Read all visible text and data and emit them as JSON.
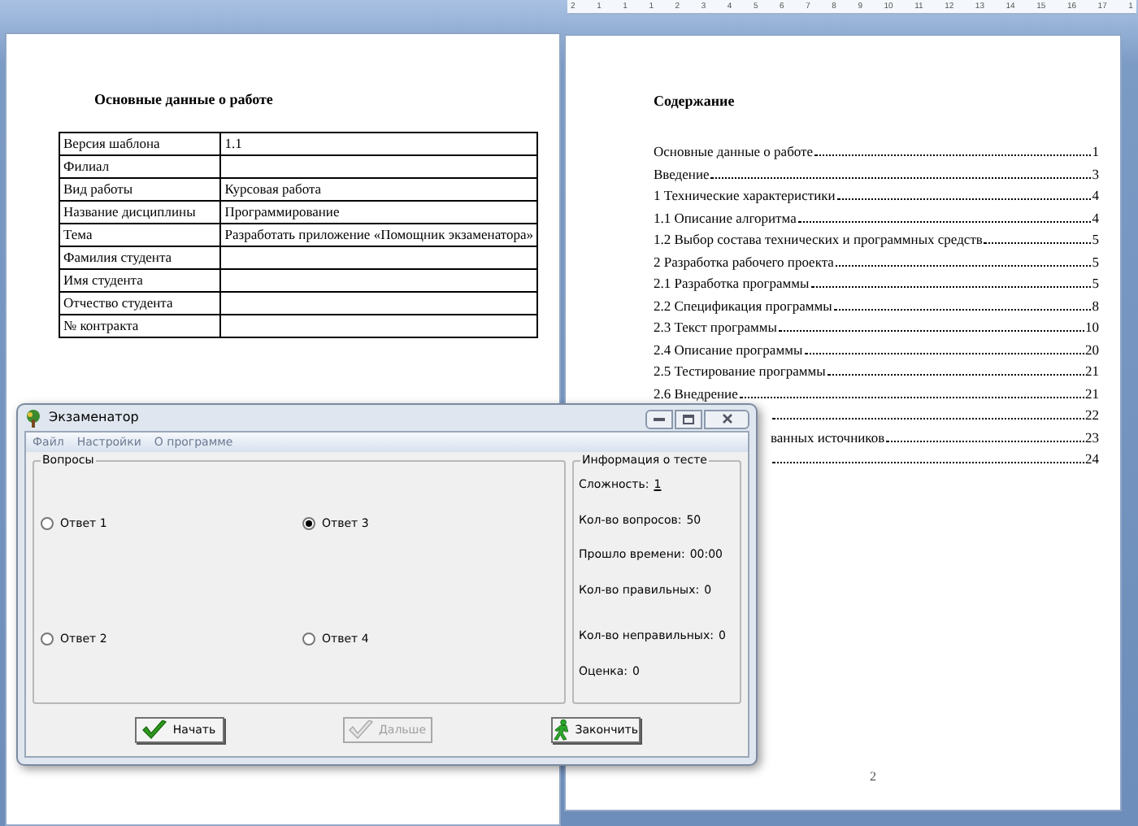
{
  "ruler": {
    "labels": [
      "2",
      "1",
      "1",
      "1",
      "2",
      "3",
      "4",
      "5",
      "6",
      "7",
      "8",
      "9",
      "10",
      "11",
      "12",
      "13",
      "14",
      "15",
      "16",
      "17",
      "1"
    ]
  },
  "left_page": {
    "heading": "Основные данные о работе",
    "table": {
      "rows": [
        {
          "label": "Версия шаблона",
          "value": "1.1"
        },
        {
          "label": "Филиал"
        },
        {
          "label": "Вид работы",
          "value": "Курсовая работа"
        },
        {
          "label": "Название дисциплины",
          "value": "Программирование"
        },
        {
          "label": "Тема",
          "value": "Разработать приложение «Помощник экзаменатора»"
        },
        {
          "label": "Фамилия студента"
        },
        {
          "label": "Имя студента"
        },
        {
          "label": "Отчество студента"
        },
        {
          "label": "№ контракта"
        }
      ]
    }
  },
  "right_page": {
    "heading": "Содержание",
    "toc": [
      {
        "title": "Основные данные о работе",
        "page": "1",
        "cut": false
      },
      {
        "title": "Введение",
        "page": "3",
        "cut": false
      },
      {
        "title": "1 Технические характеристики",
        "page": "4",
        "cut": false
      },
      {
        "title": "1.1 Описание алгоритма",
        "page": "4",
        "cut": false
      },
      {
        "title": "1.2 Выбор состава технических и программных средств",
        "page": "5",
        "cut": false
      },
      {
        "title": "2 Разработка рабочего проекта",
        "page": "5",
        "cut": false
      },
      {
        "title": "2.1 Разработка программы",
        "page": "5",
        "cut": false
      },
      {
        "title": "2.2 Спецификация программы",
        "page": "8",
        "cut": false
      },
      {
        "title": "2.3 Текст программы",
        "page": "10",
        "cut": false
      },
      {
        "title": "2.4 Описание программы",
        "page": "20",
        "cut": false
      },
      {
        "title": "2.5 Тестирование программы",
        "page": "21",
        "cut": false
      },
      {
        "title": "2.6 Внедрение",
        "page": "21",
        "cut": false
      },
      {
        "page": "22",
        "cut": true
      },
      {
        "title": "ванных источников",
        "page": "23",
        "cut": true
      },
      {
        "page": "24",
        "cut": true
      }
    ],
    "page_number": "2"
  },
  "dialog": {
    "title": "Экзаменатор",
    "menu": [
      "Файл",
      "Настройки",
      "О программе"
    ],
    "questions": {
      "title": "Вопросы",
      "answers": [
        {
          "label": "Ответ 1",
          "selected": false
        },
        {
          "label": "Ответ 3",
          "selected": true
        },
        {
          "label": "Ответ 2",
          "selected": false
        },
        {
          "label": "Ответ 4",
          "selected": false
        }
      ]
    },
    "info": {
      "title": "Информация о тесте",
      "items": [
        {
          "kind": "link",
          "label": "Сложность:",
          "value": "1"
        },
        {
          "kind": "text",
          "label": "Кол-во вопросов:",
          "value": "50"
        },
        {
          "kind": "text",
          "label": "Прошло времени:",
          "value": "00:00"
        },
        {
          "kind": "text",
          "label": "Кол-во правильных:",
          "value": "0"
        },
        {
          "kind": "text",
          "label": "Кол-во неправильных:",
          "value": "0"
        },
        {
          "kind": "text",
          "label": "Оценка:",
          "value": "0"
        }
      ]
    },
    "buttons": [
      {
        "label": "Начать",
        "disabled": false
      },
      {
        "label": "Дальше",
        "disabled": true
      },
      {
        "label": "Закончить",
        "disabled": false
      }
    ]
  }
}
